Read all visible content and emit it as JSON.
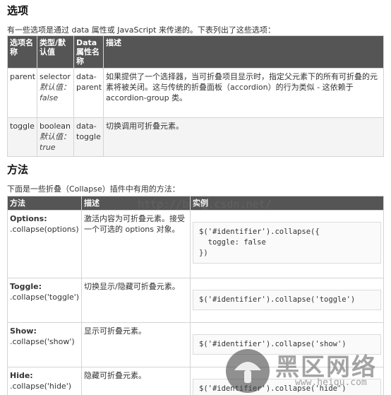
{
  "options_section": {
    "title": "选项",
    "intro": "有一些选项是通过 data 属性或 JavaScript 来传递的。下表列出了这些选项：",
    "headers": [
      "选项名称",
      "类型/默认值",
      "Data 属性名称",
      "描述"
    ],
    "rows": [
      {
        "name": "parent",
        "type": "selector",
        "default": "默认值：false",
        "data_attr": "data-parent",
        "desc": "如果提供了一个选择器，当可折叠项目显示时，指定父元素下的所有可折叠的元素将被关闭。这与传统的折叠面板（accordion）的行为类似 - 这依赖于 accordion-group 类。"
      },
      {
        "name": "toggle",
        "type": "boolean",
        "default": "默认值：true",
        "data_attr": "data-toggle",
        "desc": "切换调用可折叠元素。"
      }
    ]
  },
  "methods_section": {
    "title": "方法",
    "intro": "下面是一些折叠（Collapse）插件中有用的方法：",
    "headers": [
      "方法",
      "描述",
      "实例"
    ],
    "rows": [
      {
        "name": "Options:",
        "call": ".collapse(options)",
        "desc": "激活内容为可折叠元素。接受一个可选的 options 对象。",
        "code": [
          "$('#identifier').collapse({",
          "  toggle: false",
          "})"
        ]
      },
      {
        "name": "Toggle:",
        "call": ".collapse('toggle')",
        "desc": "切换显示/隐藏可折叠元素。",
        "code": [
          "$('#identifier').collapse('toggle')"
        ]
      },
      {
        "name": "Show:",
        "call": ".collapse('show')",
        "desc": "显示可折叠元素。",
        "code": [
          "$('#identifier').collapse('show')"
        ]
      },
      {
        "name": "Hide:",
        "call": ".collapse('hide')",
        "desc": "隐藏可折叠元素。",
        "code": [
          "$('#identifier').collapse('hide')"
        ]
      }
    ]
  },
  "watermark": {
    "url": "http://blog.csdn.net/",
    "logo_title": "黑区网络",
    "logo_url": "www.heiqu.com"
  }
}
